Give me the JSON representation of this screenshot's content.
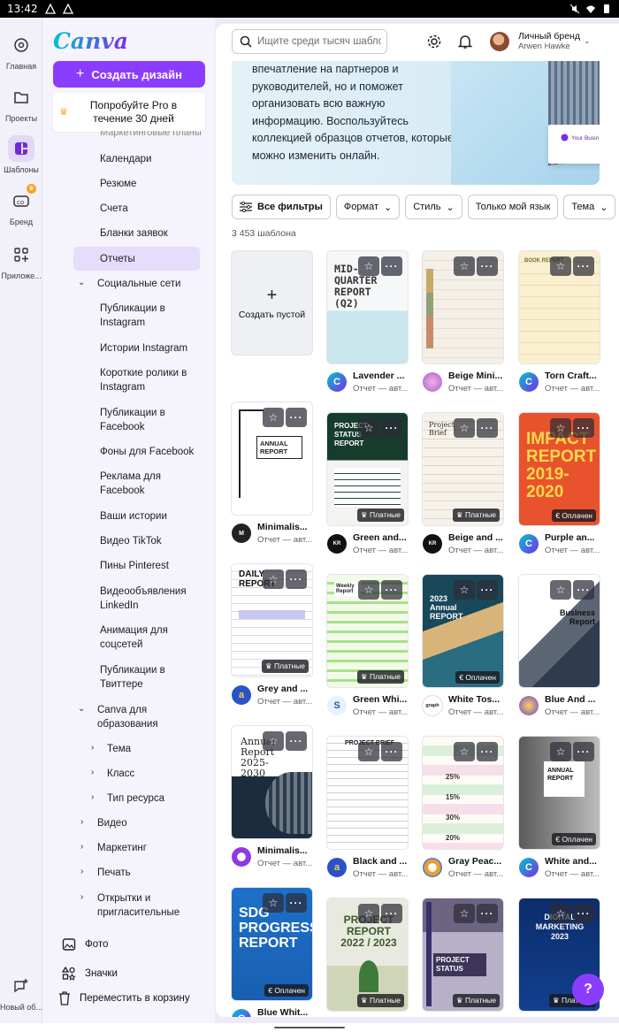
{
  "status": {
    "time": "13:42"
  },
  "rail": [
    {
      "label": "Главная",
      "icon": "home-icon"
    },
    {
      "label": "Проекты",
      "icon": "folder-icon"
    },
    {
      "label": "Шаблоны",
      "icon": "templates-icon"
    },
    {
      "label": "Бренд",
      "icon": "brand-icon"
    },
    {
      "label": "Приложе...",
      "icon": "apps-icon"
    }
  ],
  "rail_bottom": {
    "label": "Новый об...",
    "icon": "new-chat-icon"
  },
  "logo": "Canva",
  "create_button": "Создать дизайн",
  "pro_card": "Попробуйте Pro в течение 30 дней",
  "nav": [
    {
      "label": "Календари"
    },
    {
      "label": "Резюме"
    },
    {
      "label": "Счета"
    },
    {
      "label": "Бланки заявок"
    },
    {
      "label": "Отчеты"
    },
    {
      "label": "Социальные сети"
    },
    {
      "label": "Публикации в Instagram"
    },
    {
      "label": "Истории Instagram"
    },
    {
      "label": "Короткие ролики в Instagram"
    },
    {
      "label": "Публикации в Facebook"
    },
    {
      "label": "Фоны для Facebook"
    },
    {
      "label": "Реклама для Facebook"
    },
    {
      "label": "Ваши истории"
    },
    {
      "label": "Видео TikTok"
    },
    {
      "label": "Пины Pinterest"
    },
    {
      "label": "Видеообъявления LinkedIn"
    },
    {
      "label": "Анимация для соцсетей"
    },
    {
      "label": "Публикации в Твиттере"
    },
    {
      "label": "Canva для образования"
    },
    {
      "label": "Тема"
    },
    {
      "label": "Класс"
    },
    {
      "label": "Тип ресурса"
    },
    {
      "label": "Видео"
    },
    {
      "label": "Маркетинг"
    },
    {
      "label": "Печать"
    },
    {
      "label": "Открытки и пригласительные"
    }
  ],
  "panel_bottom": [
    {
      "label": "Фото",
      "icon": "photo-icon"
    },
    {
      "label": "Значки",
      "icon": "shapes-icon"
    },
    {
      "label": "Переместить в корзину",
      "icon": "trash-icon"
    }
  ],
  "search": {
    "placeholder": "Ищите среди тысяч шаблонов"
  },
  "account": {
    "brand": "Личный бренд",
    "user": "Arwen Hawke"
  },
  "hero_text": "впечатление на партнеров и руководителей, но и поможет организовать всю важную информацию. Воспользуйтесь коллекцией образцов отчетов, которые можно изменить онлайн.",
  "hero_card_text": "Your Busin",
  "filters": [
    "Все фильтры",
    "Формат",
    "Стиль",
    "Только мой язык",
    "Тема"
  ],
  "result_count": "3 453 шаблона",
  "blank_label": "Создать пустой",
  "templates": [
    {
      "title": "Lavender ...",
      "sub": "Отчет — авт...",
      "badge": "",
      "thumb_text": "MID-QUARTER REPORT (Q2)"
    },
    {
      "title": "Beige Mini...",
      "sub": "Отчет — авт...",
      "badge": "",
      "thumb_text": ""
    },
    {
      "title": "Torn Craft...",
      "sub": "Отчет — авт...",
      "badge": "",
      "thumb_text": "BOOK REPORT"
    },
    {
      "title": "Minimalis...",
      "sub": "Отчет — авт...",
      "badge": "",
      "thumb_text": "ANNUAL REPORT"
    },
    {
      "title": "Green and...",
      "sub": "Отчет — авт...",
      "badge": "Платные",
      "thumb_text": "PROJECT STATUS REPORT"
    },
    {
      "title": "Beige and ...",
      "sub": "Отчет — авт...",
      "badge": "Платные",
      "thumb_text": "Project Brief"
    },
    {
      "title": "Purple an...",
      "sub": "Отчет — авт...",
      "badge": "Оплачен",
      "thumb_text": "IMPACT REPORT 2019-2020"
    },
    {
      "title": "Grey and ...",
      "sub": "Отчет — авт...",
      "badge": "Платные",
      "thumb_text": "DAILY REPORT"
    },
    {
      "title": "Green Whi...",
      "sub": "Отчет — авт...",
      "badge": "Платные",
      "thumb_text": "Weekly Report"
    },
    {
      "title": "White Tos...",
      "sub": "Отчет — авт...",
      "badge": "Оплачен",
      "thumb_text": "2023 Annual REPORT"
    },
    {
      "title": "Blue And ...",
      "sub": "Отчет — авт...",
      "badge": "",
      "thumb_text": "Business Report"
    },
    {
      "title": "Minimalis...",
      "sub": "Отчет — авт...",
      "badge": "",
      "thumb_text": "Annual Report 2025-2030"
    },
    {
      "title": "Black and ...",
      "sub": "Отчет — авт...",
      "badge": "",
      "thumb_text": "PROJECT BRIEF"
    },
    {
      "title": "Gray Peac...",
      "sub": "Отчет — авт...",
      "badge": "",
      "thumb_text": "25% 15% 30% 20%"
    },
    {
      "title": "White and...",
      "sub": "Отчет — авт...",
      "badge": "Оплачен",
      "thumb_text": "ANNUAL REPORT"
    },
    {
      "title": "Blue Whit...",
      "sub": "",
      "badge": "Оплачен",
      "thumb_text": "SDG PROGRESS REPORT"
    },
    {
      "title": "",
      "sub": "",
      "badge": "Платные",
      "thumb_text": "PROJECT REPORT 2022 / 2023"
    },
    {
      "title": "",
      "sub": "",
      "badge": "Платные",
      "thumb_text": "PROJECT STATUS"
    },
    {
      "title": "",
      "sub": "",
      "badge": "Платные",
      "thumb_text": "DIGITAL MARKETING 2023"
    }
  ],
  "colors": {
    "accent": "#8b3dff",
    "panel": "#f5f3fc"
  }
}
